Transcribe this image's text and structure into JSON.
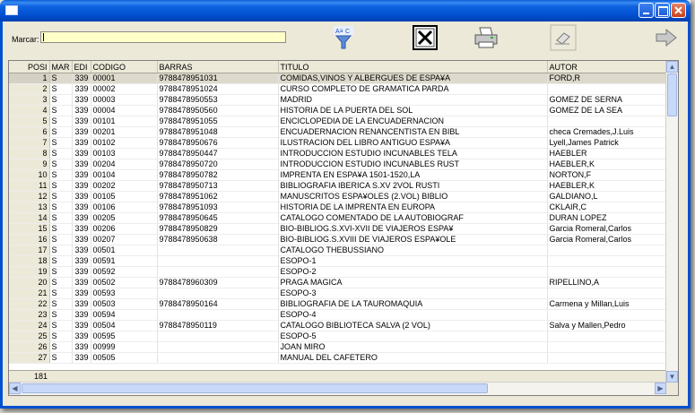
{
  "window": {
    "title": "",
    "buttons": [
      "minimize",
      "maximize",
      "close"
    ]
  },
  "toolbar": {
    "marcar_label": "Marcar:",
    "marcar_value": "",
    "buttons": [
      {
        "name": "sort-button",
        "icon": "sort-az-funnel-icon"
      },
      {
        "name": "excel-button",
        "icon": "excel-icon"
      },
      {
        "name": "print-button",
        "icon": "printer-icon"
      },
      {
        "name": "erase-button",
        "icon": "eraser-icon"
      },
      {
        "name": "exit-button",
        "icon": "exit-arrow-icon"
      }
    ]
  },
  "grid": {
    "columns": [
      "POSI",
      "MAR",
      "EDI",
      "CODIGO",
      "BARRAS",
      "TITULO",
      "AUTOR"
    ],
    "rows": [
      [
        "1",
        "S",
        "339",
        "00001",
        "9788478951031",
        "COMIDAS,VINOS Y ALBERGUES DE ESPA¥A",
        "FORD,R"
      ],
      [
        "2",
        "S",
        "339",
        "00002",
        "9788478951024",
        "CURSO COMPLETO DE GRAMATICA PARDA",
        ""
      ],
      [
        "3",
        "S",
        "339",
        "00003",
        "9788478950553",
        "MADRID",
        "GOMEZ DE SERNA"
      ],
      [
        "4",
        "S",
        "339",
        "00004",
        "9788478950560",
        "HISTORIA DE LA PUERTA DEL SOL",
        "GOMEZ DE LA SEA"
      ],
      [
        "5",
        "S",
        "339",
        "00101",
        "9788478951055",
        "ENCICLOPEDIA DE LA ENCUADERNACION",
        ""
      ],
      [
        "6",
        "S",
        "339",
        "00201",
        "9788478951048",
        "ENCUADERNACION RENANCENTISTA EN BIBL",
        "checa Cremades,J.Luis"
      ],
      [
        "7",
        "S",
        "339",
        "00102",
        "9788478950676",
        "ILUSTRACION DEL LIBRO ANTIGUO ESPA¥A",
        "Lyell,James Patrick"
      ],
      [
        "8",
        "S",
        "339",
        "00103",
        "9788478950447",
        "INTRODUCCION ESTUDIO INCUNABLES TELA",
        "HAEBLER"
      ],
      [
        "9",
        "S",
        "339",
        "00204",
        "9788478950720",
        "INTRODUCCION ESTUDIO INCUNABLES RUST",
        "HAEBLER,K"
      ],
      [
        "10",
        "S",
        "339",
        "00104",
        "9788478950782",
        "IMPRENTA EN ESPA¥A 1501-1520,LA",
        "NORTON,F"
      ],
      [
        "11",
        "S",
        "339",
        "00202",
        "9788478950713",
        "BIBLIOGRAFIA IBERICA S.XV 2VOL RUSTI",
        "HAEBLER,K"
      ],
      [
        "12",
        "S",
        "339",
        "00105",
        "9788478951062",
        "MANUSCRITOS ESPA¥OLES (2.VOL) BIBLIO",
        "GALDIANO,L"
      ],
      [
        "13",
        "S",
        "339",
        "00106",
        "9788478951093",
        "HISTORIA DE LA IMPRENTA EN EUROPA",
        "CKLAIR,C"
      ],
      [
        "14",
        "S",
        "339",
        "00205",
        "9788478950645",
        "CATALOGO COMENTADO DE LA AUTOBIOGRAF",
        "DURAN LOPEZ"
      ],
      [
        "15",
        "S",
        "339",
        "00206",
        "9788478950829",
        "BIO-BIBLIOG.S.XVI-XVII DE VIAJEROS ESPA¥",
        "Garcia Romeral,Carlos"
      ],
      [
        "16",
        "S",
        "339",
        "00207",
        "9788478950638",
        "BIO-BIBLIOG.S.XVIII DE VIAJEROS ESPA¥OLE",
        "Garcia Romeral,Carlos"
      ],
      [
        "17",
        "S",
        "339",
        "00501",
        "",
        "CATALOGO THEBUSSIANO",
        ""
      ],
      [
        "18",
        "S",
        "339",
        "00591",
        "",
        "ESOPO-1",
        ""
      ],
      [
        "19",
        "S",
        "339",
        "00592",
        "",
        "ESOPO-2",
        ""
      ],
      [
        "20",
        "S",
        "339",
        "00502",
        "9788478960309",
        "PRAGA MAGICA",
        "RIPELLINO,A"
      ],
      [
        "21",
        "S",
        "339",
        "00593",
        "",
        "ESOPO-3",
        ""
      ],
      [
        "22",
        "S",
        "339",
        "00503",
        "9788478950164",
        "BIBLIOGRAFIA DE LA TAUROMAQUIA",
        "Carmena y Millan,Luis"
      ],
      [
        "23",
        "S",
        "339",
        "00594",
        "",
        "ESOPO-4",
        ""
      ],
      [
        "24",
        "S",
        "339",
        "00504",
        "9788478950119",
        "CATALOGO BIBLIOTECA SALVA (2 VOL)",
        "Salva y Mallen,Pedro"
      ],
      [
        "25",
        "S",
        "339",
        "00595",
        "",
        "ESOPO-5",
        ""
      ],
      [
        "26",
        "S",
        "339",
        "00999",
        "",
        "JOAN MIRO",
        ""
      ],
      [
        "27",
        "S",
        "339",
        "00505",
        "",
        "MANUAL DEL CAFETERO",
        ""
      ]
    ],
    "footer_count": "181"
  }
}
